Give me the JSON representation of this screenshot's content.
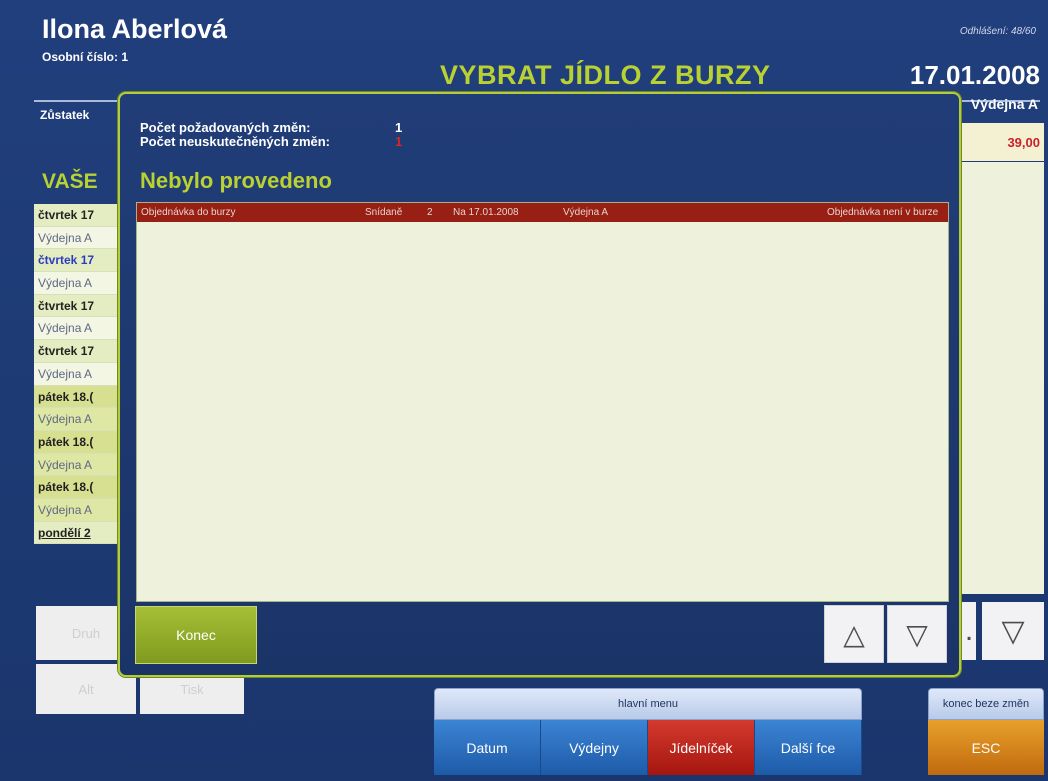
{
  "header": {
    "user_name": "Ilona Aberlová",
    "personal_number": "Osobní číslo: 1",
    "screen_title": "VYBRAT JÍDLO Z BURZY",
    "logout_counter": "Odhlášení: 48/60",
    "date": "17.01.2008",
    "balance_label": "Zůstatek",
    "canteen": "Výdejna A",
    "amount": "39,00"
  },
  "section_title": "VAŠE",
  "orders": [
    {
      "day": "čtvrtek 17",
      "place": "Výdejna A",
      "style": "normal"
    },
    {
      "day": "čtvrtek 17",
      "place": "Výdejna A",
      "style": "blue"
    },
    {
      "day": "čtvrtek 17",
      "place": "Výdejna A",
      "style": "normal"
    },
    {
      "day": "čtvrtek 17",
      "place": "Výdejna A",
      "style": "normal"
    },
    {
      "day": "pátek 18.(",
      "place": "Výdejna A",
      "style": "yellow"
    },
    {
      "day": "pátek 18.(",
      "place": "Výdejna A",
      "style": "yellow"
    },
    {
      "day": "pátek 18.(",
      "place": "Výdejna A",
      "style": "yellow"
    },
    {
      "day": "pondělí 2",
      "place": "",
      "style": "last"
    }
  ],
  "bottom_left": {
    "btn1": "Druh",
    "btn2": "Alt",
    "btn3": "Tisk"
  },
  "dialog": {
    "requested_changes_label": "Počet požadovaných změn:",
    "requested_changes_value": "1",
    "failed_changes_label": "Počet neuskutečněných změn:",
    "failed_changes_value": "1",
    "title": "Nebylo provedeno",
    "results": [
      {
        "action": "Objednávka do burzy",
        "meal": "Snídaně",
        "count": "2",
        "date": "Na 17.01.2008",
        "canteen": "Výdejna A",
        "reason": "Objednávka není v burze"
      }
    ],
    "konec_label": "Konec",
    "arrow_up": "△",
    "arrow_down": "▽"
  },
  "background_arrows": {
    "dot": ".",
    "down": "▽"
  },
  "main_menu": {
    "label": "hlavní menu",
    "items": [
      "Datum",
      "Výdejny",
      "Jídelníček",
      "Další fce"
    ],
    "active_index": 2
  },
  "exit": {
    "label": "konec beze změn",
    "esc": "ESC"
  },
  "colors": {
    "accent_green": "#b9d131",
    "background_blue": "#1f3d78",
    "error_row": "#971f13",
    "active_menu": "#c4261d",
    "esc_orange": "#d88420"
  }
}
